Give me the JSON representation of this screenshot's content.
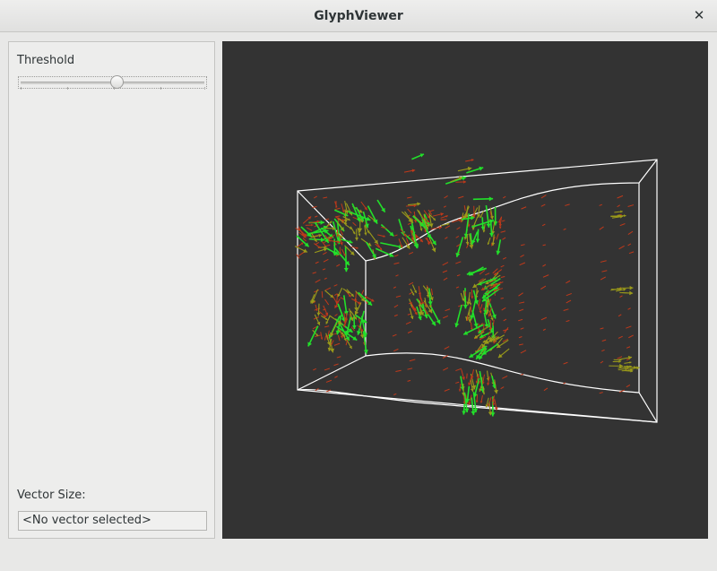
{
  "window": {
    "title": "GlyphViewer",
    "close_glyph": "✕"
  },
  "controls": {
    "threshold_label": "Threshold",
    "threshold_level": 0.52,
    "vector_size_label": "Vector Size:",
    "vector_size_value": "<No vector selected>"
  },
  "viewport": {
    "background": "#333333",
    "outline_color": "#ffffff",
    "glyph_colors": {
      "strong": "#22e02a",
      "mid": "#9a9a1a",
      "weak": "#c0391a"
    }
  }
}
